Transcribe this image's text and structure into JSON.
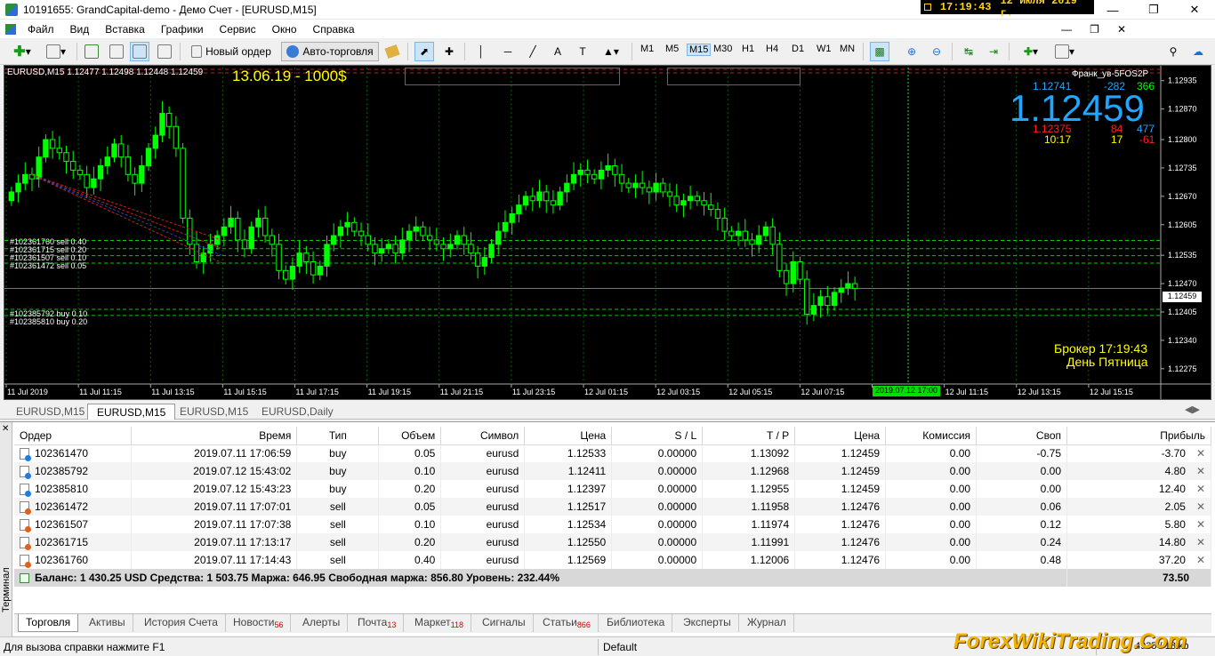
{
  "window": {
    "title": "10191655: GrandCapital-demo - Демо Счет - [EURUSD,M15]",
    "clock_time": "17:19:43",
    "clock_date": "12 июля 2019 г."
  },
  "menu": [
    "Файл",
    "Вид",
    "Вставка",
    "Графики",
    "Сервис",
    "Окно",
    "Справка"
  ],
  "toolbar": {
    "new_order": "Новый ордер",
    "auto_trading": "Авто-торговля",
    "timeframes": [
      "M1",
      "M5",
      "M15",
      "M30",
      "H1",
      "H4",
      "D1",
      "W1",
      "MN"
    ],
    "active_timeframe": "M15"
  },
  "chart": {
    "header": "EURUSD,M15  1.12477 1.12498 1.12448 1.12459",
    "promo_text": "13.06.19 - 1000$",
    "account_label": "Франк_ув-5FOS2P",
    "bid_small": "1.12741",
    "spread_a": "-282",
    "spread_b": "366",
    "big_price": "1.12459",
    "low_val": "1.12375",
    "low_b": "84",
    "low_c": "477",
    "time_val": "10:17",
    "time_b": "17",
    "time_c": "-61",
    "broker_time": "Брокер 17:19:43",
    "day_label": "День Пятница",
    "current_price_label": "1.12459",
    "time_cursor_label": "2019.07.12 17:00",
    "order_labels": [
      "#102361760 sell 0.40",
      "#102361715 sell 0.20",
      "#102361507 sell 0.10",
      "#102361472 sell 0.05",
      "#102385792 buy 0.10",
      "#102385810 buy 0.20"
    ],
    "colors": {
      "bull": "#00ff00",
      "bear": "#000000",
      "grid": "#0b5d0b",
      "text": "#ffffff",
      "yellow": "#ffff00",
      "blue": "#1ea7ff"
    }
  },
  "chart_data": {
    "type": "candlestick",
    "symbol": "EURUSD",
    "timeframe": "M15",
    "y_ticks": [
      1.12935,
      1.1287,
      1.128,
      1.12735,
      1.1267,
      1.12605,
      1.12535,
      1.1247,
      1.12405,
      1.1234,
      1.12275
    ],
    "ylim": [
      1.1224,
      1.12965
    ],
    "x_ticks": [
      "11 Jul 2019",
      "11 Jul 11:15",
      "11 Jul 13:15",
      "11 Jul 15:15",
      "11 Jul 17:15",
      "11 Jul 19:15",
      "11 Jul 21:15",
      "11 Jul 23:15",
      "12 Jul 01:15",
      "12 Jul 03:15",
      "12 Jul 05:15",
      "12 Jul 07:15",
      "12 Jul 09:15",
      "12 Jul 11:15",
      "12 Jul 13:15",
      "12 Jul 15:15"
    ],
    "x_ticks_visible": [
      "11 Jul 2019",
      "11 Jul 11:15",
      "11 Jul 13:15",
      "11 Jul 15:15",
      "11 Jul 17:15",
      "11 Jul 19:15",
      "11 Jul 21:15",
      "11 Jul 23:15",
      "12 Jul 01:15",
      "12 Jul 03:15",
      "12 Jul 05:15",
      "12 Jul 07:15",
      "12 Jul 09:15",
      "12 Jul 11:15",
      "12 Jul 13:15",
      "12 Jul 15:15"
    ],
    "order_levels": [
      1.12569,
      1.1255,
      1.12534,
      1.12517,
      1.12411,
      1.12397
    ],
    "current_price": 1.12459,
    "close": [
      1.1268,
      1.127,
      1.1272,
      1.1271,
      1.1276,
      1.128,
      1.1278,
      1.1277,
      1.1275,
      1.1273,
      1.1272,
      1.1269,
      1.1271,
      1.1274,
      1.1276,
      1.1279,
      1.1276,
      1.1272,
      1.127,
      1.1274,
      1.1278,
      1.1281,
      1.1286,
      1.1283,
      1.1278,
      1.1262,
      1.1256,
      1.1252,
      1.1254,
      1.1256,
      1.1258,
      1.126,
      1.1262,
      1.1257,
      1.1255,
      1.126,
      1.1262,
      1.1258,
      1.1256,
      1.125,
      1.1248,
      1.1251,
      1.1254,
      1.1252,
      1.1249,
      1.1251,
      1.1256,
      1.1258,
      1.126,
      1.1261,
      1.1259,
      1.1258,
      1.1256,
      1.1254,
      1.1255,
      1.1256,
      1.1254,
      1.1257,
      1.1259,
      1.126,
      1.1258,
      1.1257,
      1.1256,
      1.1255,
      1.1256,
      1.1258,
      1.1256,
      1.1254,
      1.1251,
      1.1253,
      1.1256,
      1.1259,
      1.1261,
      1.1263,
      1.1265,
      1.1267,
      1.1266,
      1.1268,
      1.1266,
      1.1265,
      1.1268,
      1.127,
      1.1272,
      1.1273,
      1.1272,
      1.1271,
      1.1273,
      1.1274,
      1.1272,
      1.127,
      1.1269,
      1.127,
      1.1269,
      1.1268,
      1.127,
      1.1268,
      1.1267,
      1.1265,
      1.1266,
      1.1267,
      1.1266,
      1.1265,
      1.1264,
      1.1262,
      1.1259,
      1.1258,
      1.1259,
      1.1257,
      1.1256,
      1.1258,
      1.126,
      1.1256,
      1.125,
      1.1247,
      1.1252,
      1.1248,
      1.124,
      1.1242,
      1.1244,
      1.1242,
      1.1245,
      1.1246,
      1.1247,
      1.12459
    ]
  },
  "chart_tabs": [
    "EURUSD,M15",
    "EURUSD,M15",
    "EURUSD,M15",
    "EURUSD,Daily"
  ],
  "chart_tab_active": 1,
  "terminal": {
    "side_label": "Терминал",
    "columns": [
      "Ордер",
      "Время",
      "Тип",
      "Объем",
      "Символ",
      "Цена",
      "S / L",
      "T / P",
      "Цена",
      "Комиссия",
      "Своп",
      "Прибыль"
    ],
    "rows": [
      {
        "order": "102361470",
        "time": "2019.07.11 17:06:59",
        "type": "buy",
        "volume": "0.05",
        "symbol": "eurusd",
        "price": "1.12533",
        "sl": "0.00000",
        "tp": "1.13092",
        "cur": "1.12459",
        "comm": "0.00",
        "swap": "-0.75",
        "profit": "-3.70"
      },
      {
        "order": "102385792",
        "time": "2019.07.12 15:43:02",
        "type": "buy",
        "volume": "0.10",
        "symbol": "eurusd",
        "price": "1.12411",
        "sl": "0.00000",
        "tp": "1.12968",
        "cur": "1.12459",
        "comm": "0.00",
        "swap": "0.00",
        "profit": "4.80"
      },
      {
        "order": "102385810",
        "time": "2019.07.12 15:43:23",
        "type": "buy",
        "volume": "0.20",
        "symbol": "eurusd",
        "price": "1.12397",
        "sl": "0.00000",
        "tp": "1.12955",
        "cur": "1.12459",
        "comm": "0.00",
        "swap": "0.00",
        "profit": "12.40"
      },
      {
        "order": "102361472",
        "time": "2019.07.11 17:07:01",
        "type": "sell",
        "volume": "0.05",
        "symbol": "eurusd",
        "price": "1.12517",
        "sl": "0.00000",
        "tp": "1.11958",
        "cur": "1.12476",
        "comm": "0.00",
        "swap": "0.06",
        "profit": "2.05"
      },
      {
        "order": "102361507",
        "time": "2019.07.11 17:07:38",
        "type": "sell",
        "volume": "0.10",
        "symbol": "eurusd",
        "price": "1.12534",
        "sl": "0.00000",
        "tp": "1.11974",
        "cur": "1.12476",
        "comm": "0.00",
        "swap": "0.12",
        "profit": "5.80"
      },
      {
        "order": "102361715",
        "time": "2019.07.11 17:13:17",
        "type": "sell",
        "volume": "0.20",
        "symbol": "eurusd",
        "price": "1.12550",
        "sl": "0.00000",
        "tp": "1.11991",
        "cur": "1.12476",
        "comm": "0.00",
        "swap": "0.24",
        "profit": "14.80"
      },
      {
        "order": "102361760",
        "time": "2019.07.11 17:14:43",
        "type": "sell",
        "volume": "0.40",
        "symbol": "eurusd",
        "price": "1.12569",
        "sl": "0.00000",
        "tp": "1.12006",
        "cur": "1.12476",
        "comm": "0.00",
        "swap": "0.48",
        "profit": "37.20"
      }
    ],
    "balance_line": "Баланс: 1 430.25 USD  Средства: 1 503.75  Маржа: 646.95  Свободная маржа: 856.80  Уровень: 232.44%",
    "total_profit": "73.50"
  },
  "bottom_tabs": [
    {
      "label": "Торговля",
      "badge": ""
    },
    {
      "label": "Активы",
      "badge": ""
    },
    {
      "label": "История Счета",
      "badge": ""
    },
    {
      "label": "Новости",
      "badge": "56"
    },
    {
      "label": "Алерты",
      "badge": ""
    },
    {
      "label": "Почта",
      "badge": "13"
    },
    {
      "label": "Маркет",
      "badge": "118"
    },
    {
      "label": "Сигналы",
      "badge": ""
    },
    {
      "label": "Статьи",
      "badge": "866"
    },
    {
      "label": "Библиотека",
      "badge": ""
    },
    {
      "label": "Эксперты",
      "badge": ""
    },
    {
      "label": "Журнал",
      "badge": ""
    }
  ],
  "status": {
    "help": "Для вызова справки нажмите F1",
    "profile": "Default",
    "traffic": "4935 / 18 kb"
  },
  "watermark": "ForexWikiTrading.Com"
}
